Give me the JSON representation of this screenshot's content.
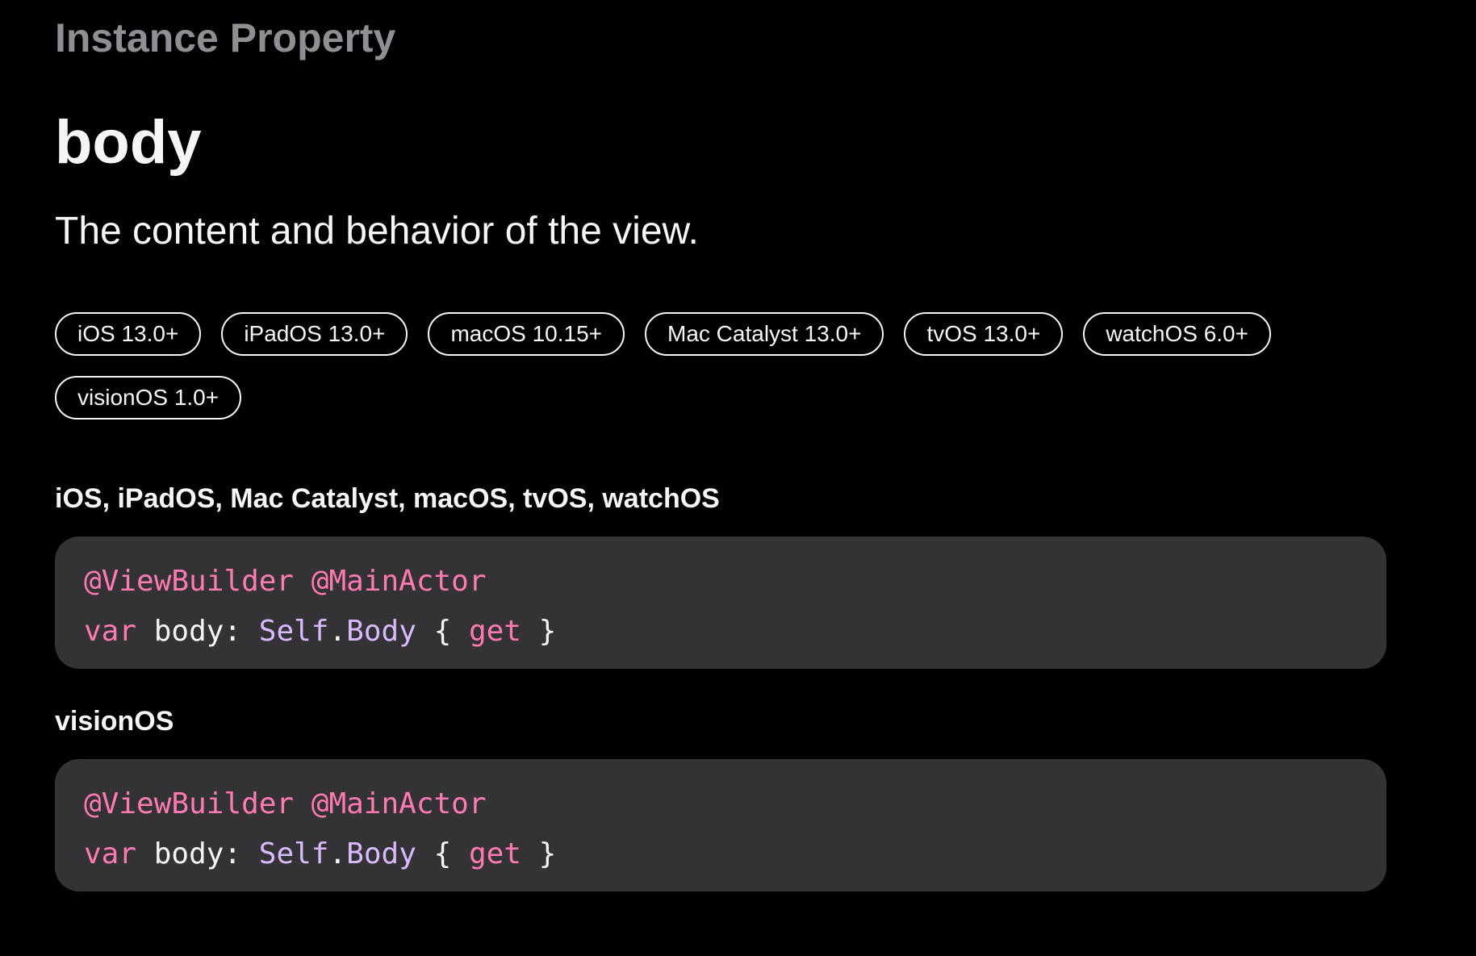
{
  "header": {
    "eyebrow": "Instance Property",
    "title": "body",
    "abstract": "The content and behavior of the view."
  },
  "availability": [
    "iOS 13.0+",
    "iPadOS 13.0+",
    "macOS 10.15+",
    "Mac Catalyst 13.0+",
    "tvOS 13.0+",
    "watchOS 6.0+",
    "visionOS 1.0+"
  ],
  "declarations": [
    {
      "label": "iOS, iPadOS, Mac Catalyst, macOS, tvOS, watchOS",
      "code": {
        "attr1": "@ViewBuilder",
        "attr2": "@MainActor",
        "keyword_var": "var",
        "name": "body:",
        "type_self": "Self",
        "dot": ".",
        "type_body": "Body",
        "brace_open": "{",
        "keyword_get": "get",
        "brace_close": "}"
      }
    },
    {
      "label": "visionOS",
      "code": {
        "attr1": "@ViewBuilder",
        "attr2": "@MainActor",
        "keyword_var": "var",
        "name": "body:",
        "type_self": "Self",
        "dot": ".",
        "type_body": "Body",
        "brace_open": "{",
        "keyword_get": "get",
        "brace_close": "}"
      }
    }
  ],
  "colors": {
    "background": "#000000",
    "eyebrow": "#8e8e93",
    "text": "#f5f5f7",
    "code_background": "#333336",
    "code_keyword": "#ff7ab2",
    "code_type": "#dabaff"
  }
}
